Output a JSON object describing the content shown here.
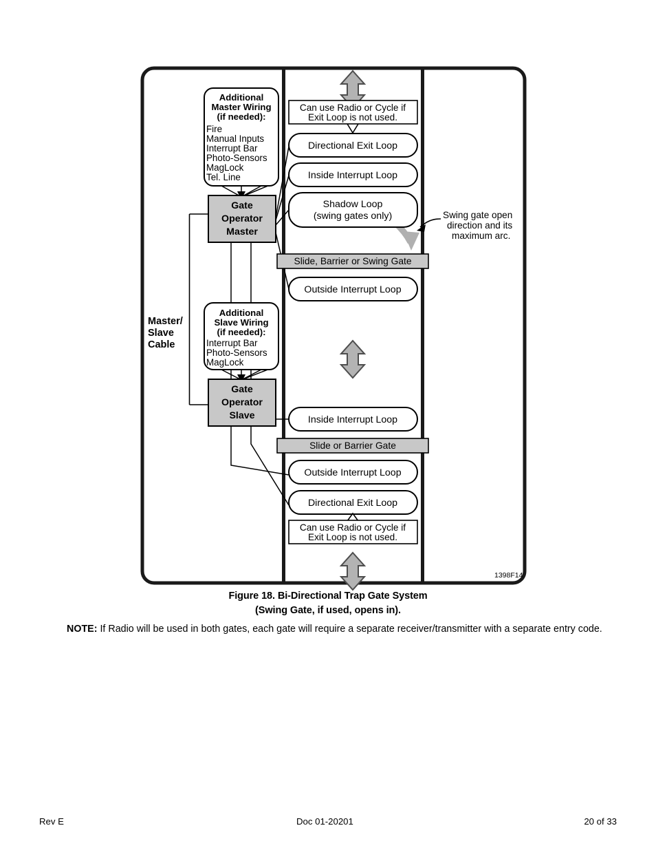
{
  "figure": {
    "id_label": "1398F14",
    "caption_line1": "Figure 18.  Bi-Directional Trap Gate System",
    "caption_line2": "(Swing Gate, if used, opens in).",
    "master_cable_label_line1": "Master/",
    "master_cable_label_line2": "Slave",
    "master_cable_label_line3": "Cable",
    "swing_note_line1": "Swing gate open",
    "swing_note_line2": "direction and its",
    "swing_note_line3": "maximum arc.",
    "master_wiring": {
      "title_line1": "Additional",
      "title_line2": "Master Wiring",
      "title_line3": "(if needed):",
      "items": [
        "Fire",
        "Manual Inputs",
        "Interrupt  Bar",
        "Photo-Sensors",
        "MagLock",
        "Tel. Line"
      ]
    },
    "slave_wiring": {
      "title_line1": "Additional",
      "title_line2": "Slave Wiring",
      "title_line3": "(if needed):",
      "items": [
        "Interrupt  Bar",
        "Photo-Sensors",
        "MagLock"
      ]
    },
    "operator_master": {
      "line1": "Gate",
      "line2": "Operator",
      "line3": "Master"
    },
    "operator_slave": {
      "line1": "Gate",
      "line2": "Operator",
      "line3": "Slave"
    },
    "gate_bar_master": "Slide, Barrier or Swing Gate",
    "gate_bar_slave": "Slide or Barrier Gate",
    "radio_note_top_line1": "Can use Radio or Cycle if",
    "radio_note_top_line2": "Exit Loop is not used.",
    "radio_note_bottom_line1": "Can use Radio or Cycle if",
    "radio_note_bottom_line2": "Exit Loop is not used.",
    "loop_top_exit": "Directional Exit Loop",
    "loop_top_inside": "Inside Interrupt  Loop",
    "loop_shadow_line1": "Shadow Loop",
    "loop_shadow_line2": "(swing gates only)",
    "loop_top_outside": "Outside Interrupt  Loop",
    "loop_bottom_inside": "Inside Interrupt  Loop",
    "loop_bottom_outside": "Outside Interrupt  Loop",
    "loop_bottom_exit": "Directional Exit Loop"
  },
  "note": {
    "label": "NOTE:",
    "text": "  If Radio will be used in both gates, each gate will require a separate receiver/transmitter with a separate entry code."
  },
  "footer": {
    "revision": "Rev E",
    "document": "Doc 01-20201",
    "page": "20 of 33"
  },
  "colors": {
    "frame": "#1a1a1a",
    "operator_fill": "#c8c8c8",
    "gate_bar_fill": "#c8c8c8",
    "arrow_gray": "#b3b3b3",
    "arc_gray": "#b0b0b0"
  }
}
